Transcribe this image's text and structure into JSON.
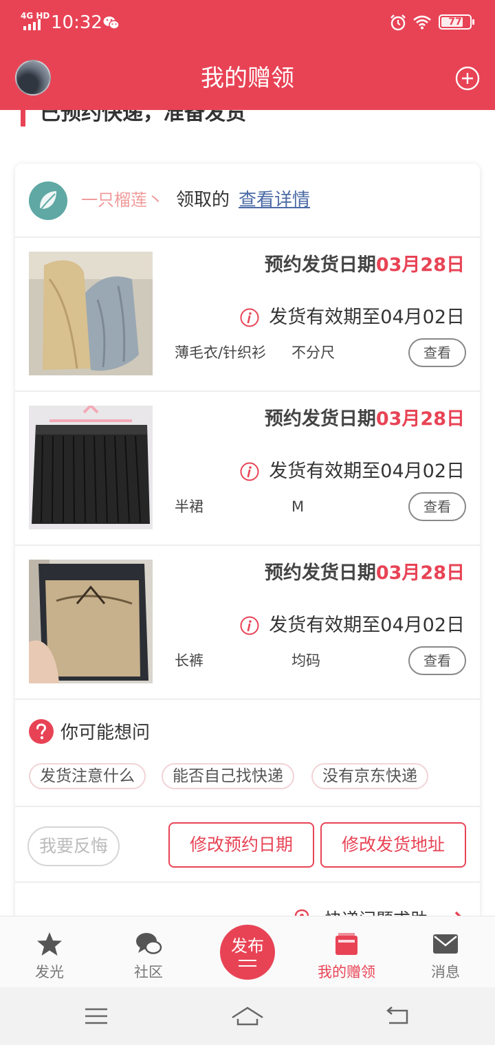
{
  "status_bar": {
    "network": "4G HD",
    "time": "10:32",
    "battery": "77",
    "battery_level": 0.77,
    "icons": [
      "signal-icon",
      "wechat-icon",
      "alarm-icon",
      "wifi-icon",
      "battery-icon"
    ]
  },
  "header": {
    "title": "我的赠领",
    "add_icon": "plus-circle-icon"
  },
  "section_title": "已预约快递，准备发货",
  "claim": {
    "user": "一只榴莲丶",
    "text": "领取的",
    "link": "查看详情"
  },
  "items": [
    {
      "date_label": "预约发货日期",
      "date_value": "03月28日",
      "valid_text": "发货有效期至04月02日",
      "category": "薄毛衣/针织衫",
      "size": "不分尺",
      "view_label": "查看"
    },
    {
      "date_label": "预约发货日期",
      "date_value": "03月28日",
      "valid_text": "发货有效期至04月02日",
      "category": "半裙",
      "size": "M",
      "view_label": "查看"
    },
    {
      "date_label": "预约发货日期",
      "date_value": "03月28日",
      "valid_text": "发货有效期至04月02日",
      "category": "长裤",
      "size": "均码",
      "view_label": "查看"
    }
  ],
  "faq": {
    "title": "你可能想问",
    "chips": [
      "发货注意什么",
      "能否自己找快递",
      "没有京东快递"
    ]
  },
  "actions": {
    "regret": "我要反悔",
    "change_date": "修改预约日期",
    "change_address": "修改发货地址"
  },
  "help": {
    "text": "快递问题求助"
  },
  "tabbar": {
    "tabs": [
      {
        "label": "发光",
        "icon": "star-icon"
      },
      {
        "label": "社区",
        "icon": "chat-bubbles-icon"
      },
      {
        "label": "发布",
        "icon": "publish-icon"
      },
      {
        "label": "我的赠领",
        "icon": "gift-box-icon"
      },
      {
        "label": "消息",
        "icon": "envelope-icon"
      }
    ],
    "active": "我的赠领"
  },
  "colors": {
    "brand": "#e84355",
    "date_highlight": "#e84355",
    "link": "#4a6aa5"
  }
}
